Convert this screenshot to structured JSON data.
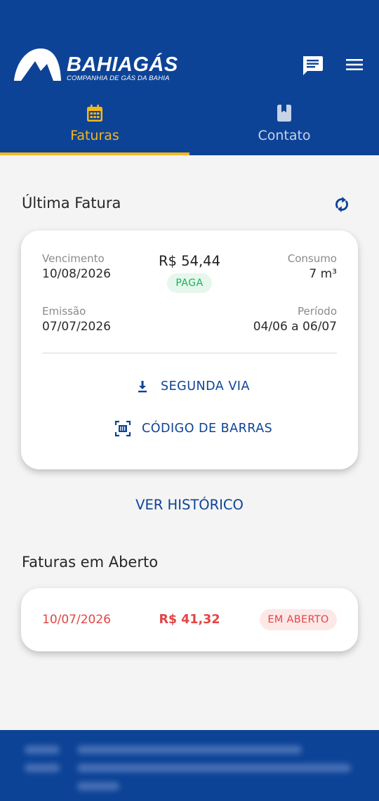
{
  "colors": {
    "brand_blue": "#0d4397",
    "accent_yellow": "#f3b81d",
    "paid_green": "#1bb05a",
    "open_red": "#e24545"
  },
  "header": {
    "brand_name": "BAHIAGÁS",
    "brand_tagline": "COMPANHIA DE GÁS DA BAHIA",
    "chat_icon": "chat-bubble-icon",
    "menu_icon": "hamburger-menu-icon"
  },
  "tabs": [
    {
      "label": "Faturas",
      "icon": "calendar-icon",
      "active": true
    },
    {
      "label": "Contato",
      "icon": "contact-book-icon",
      "active": false
    }
  ],
  "ultima_fatura": {
    "title": "Última Fatura",
    "vencimento_label": "Vencimento",
    "vencimento": "10/08/2026",
    "amount": "R$ 54,44",
    "status": "PAGA",
    "consumo_label": "Consumo",
    "consumo": "7 m³",
    "emissao_label": "Emissão",
    "emissao": "07/07/2026",
    "periodo_label": "Período",
    "periodo": "04/06 a 06/07",
    "segunda_via_label": "SEGUNDA VIA",
    "codigo_barras_label": "CÓDIGO DE BARRAS"
  },
  "ver_historico_label": "VER HISTÓRICO",
  "faturas_aberto": {
    "title": "Faturas em Aberto",
    "items": [
      {
        "date": "10/07/2026",
        "amount": "R$ 41,32",
        "status": "EM ABERTO"
      }
    ]
  }
}
